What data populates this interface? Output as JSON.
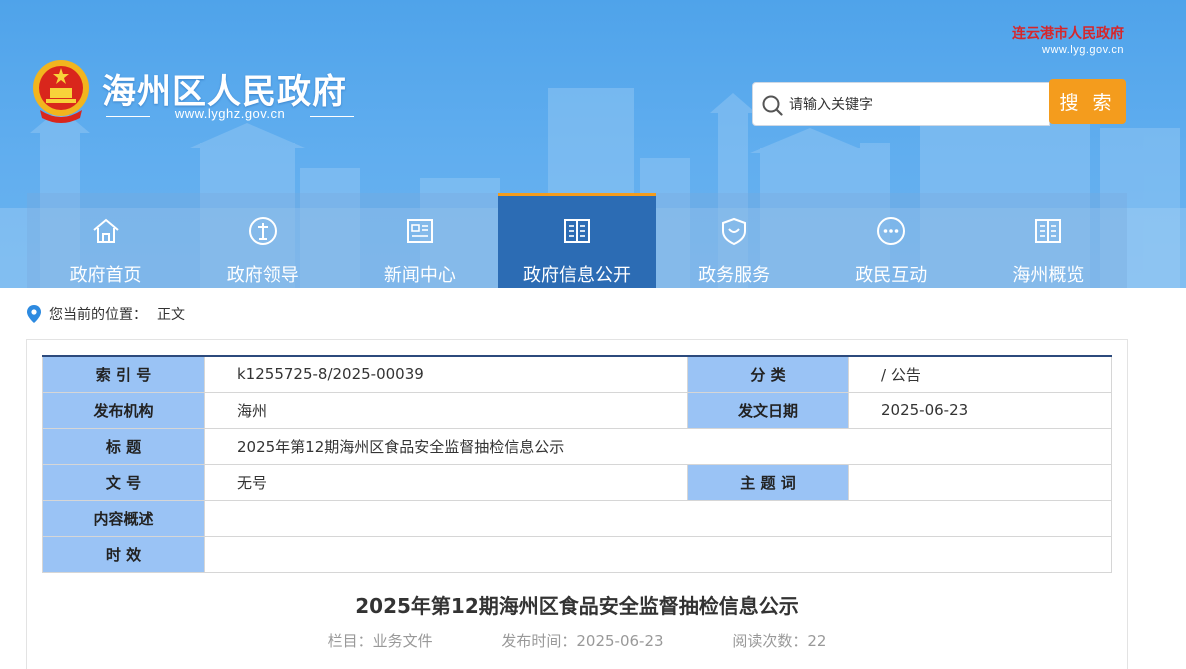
{
  "header": {
    "site_title": "海州区人民政府",
    "site_url": "www.lyghz.gov.cn",
    "city_name": "连云港市人民政府",
    "city_url": "www.lyg.gov.cn",
    "search_placeholder": "请输入关键字",
    "search_button": "搜 索"
  },
  "nav": {
    "items": [
      {
        "label": "政府首页",
        "icon": "home-icon"
      },
      {
        "label": "政府领导",
        "icon": "leader-icon"
      },
      {
        "label": "新闻中心",
        "icon": "news-icon"
      },
      {
        "label": "政府信息公开",
        "icon": "book-icon",
        "active": true
      },
      {
        "label": "政务服务",
        "icon": "shield-icon"
      },
      {
        "label": "政民互动",
        "icon": "chat-icon"
      },
      {
        "label": "海州概览",
        "icon": "overview-icon"
      }
    ]
  },
  "breadcrumb": {
    "prefix": "您当前的位置：",
    "current": "正文"
  },
  "meta": {
    "index_label": "索 引 号",
    "index_value": "k1255725-8/2025-00039",
    "category_label": "分 类",
    "category_value": "/ 公告",
    "publisher_label": "发布机构",
    "publisher_value": "海州",
    "date_label": "发文日期",
    "date_value": "2025-06-23",
    "title_label": "标 题",
    "title_value": "2025年第12期海州区食品安全监督抽检信息公示",
    "docno_label": "文 号",
    "docno_value": "无号",
    "keyword_label": "主 题 词",
    "keyword_value": "",
    "summary_label": "内容概述",
    "summary_value": "",
    "validity_label": "时 效",
    "validity_value": ""
  },
  "article": {
    "title": "2025年第12期海州区食品安全监督抽检信息公示",
    "column": "栏目：业务文件",
    "publish_time": "发布时间：2025-06-23",
    "views": "阅读次数：22"
  },
  "colors": {
    "header_blue": "#5aaaee",
    "nav_active": "#2c6cb4",
    "accent_orange": "#f49c1d",
    "table_label_bg": "#9ac3f5"
  }
}
